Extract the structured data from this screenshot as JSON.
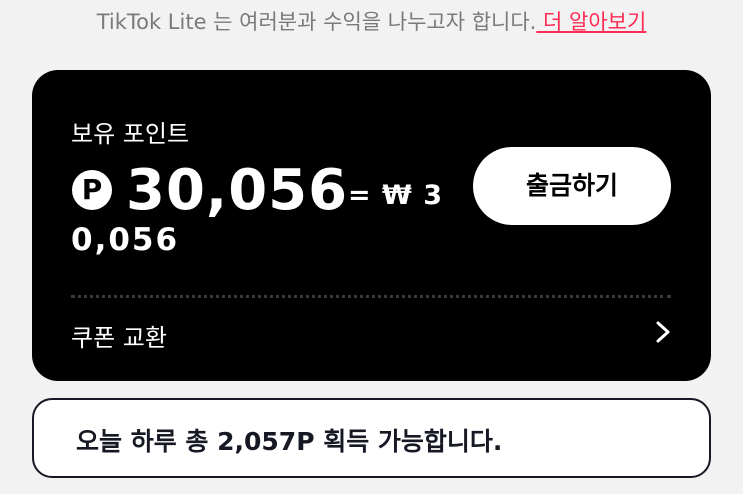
{
  "notice": {
    "text": "TikTok Lite 는 여러분과 수익을 나누고자 합니다.",
    "link": " 더 알아보기"
  },
  "points_card": {
    "title": "보유 포인트",
    "coin_symbol": "P",
    "points": "30,056",
    "won_prefix": "= ₩ 3",
    "won_suffix": "0,056",
    "withdraw_label": "출금하기",
    "coupon_label": "쿠폰 교환"
  },
  "daily": {
    "text": "오늘 하루 총 2,057P 획득 가능합니다."
  },
  "colors": {
    "accent": "#fe2c55",
    "card_bg": "#000000",
    "page_bg": "#f2f2f2"
  }
}
